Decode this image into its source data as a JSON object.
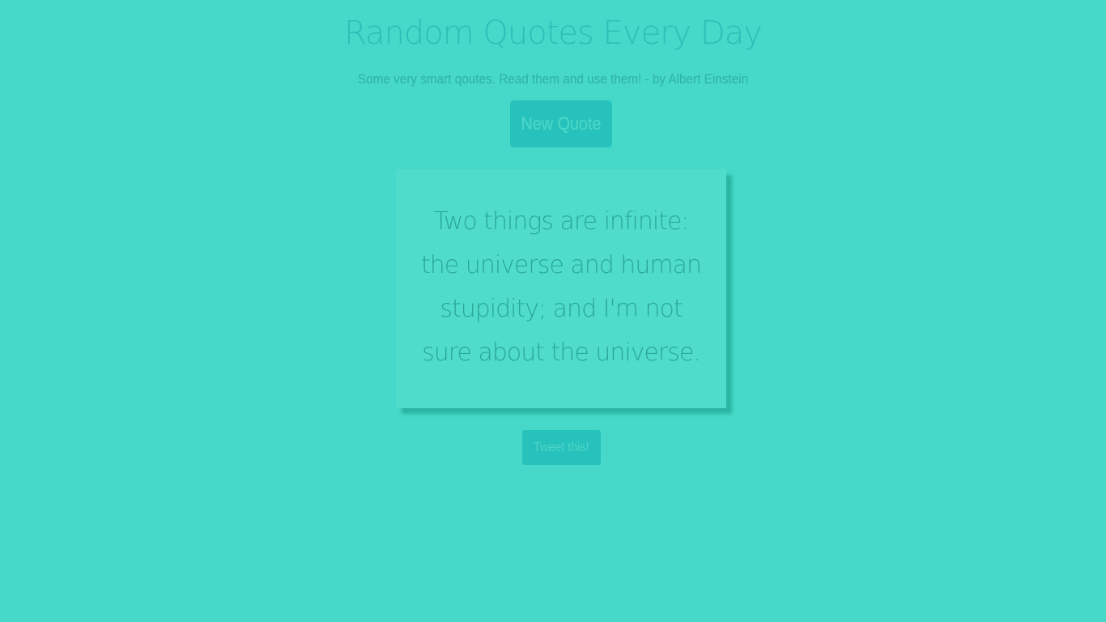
{
  "header": {
    "title": "Random Quotes Every Day",
    "subtitle": "Some very smart qoutes. Read them and use them! - by Albert Einstein"
  },
  "actions": {
    "new_quote_label": "New Quote",
    "tweet_label": "Tweet this!"
  },
  "quote": {
    "text": "Two things are infinite: the universe and human stupidity; and I'm not sure about the universe."
  },
  "colors": {
    "background": "#46d8c8",
    "button": "#26c2bb",
    "card": "#50dcca",
    "text": "#2aa898"
  }
}
